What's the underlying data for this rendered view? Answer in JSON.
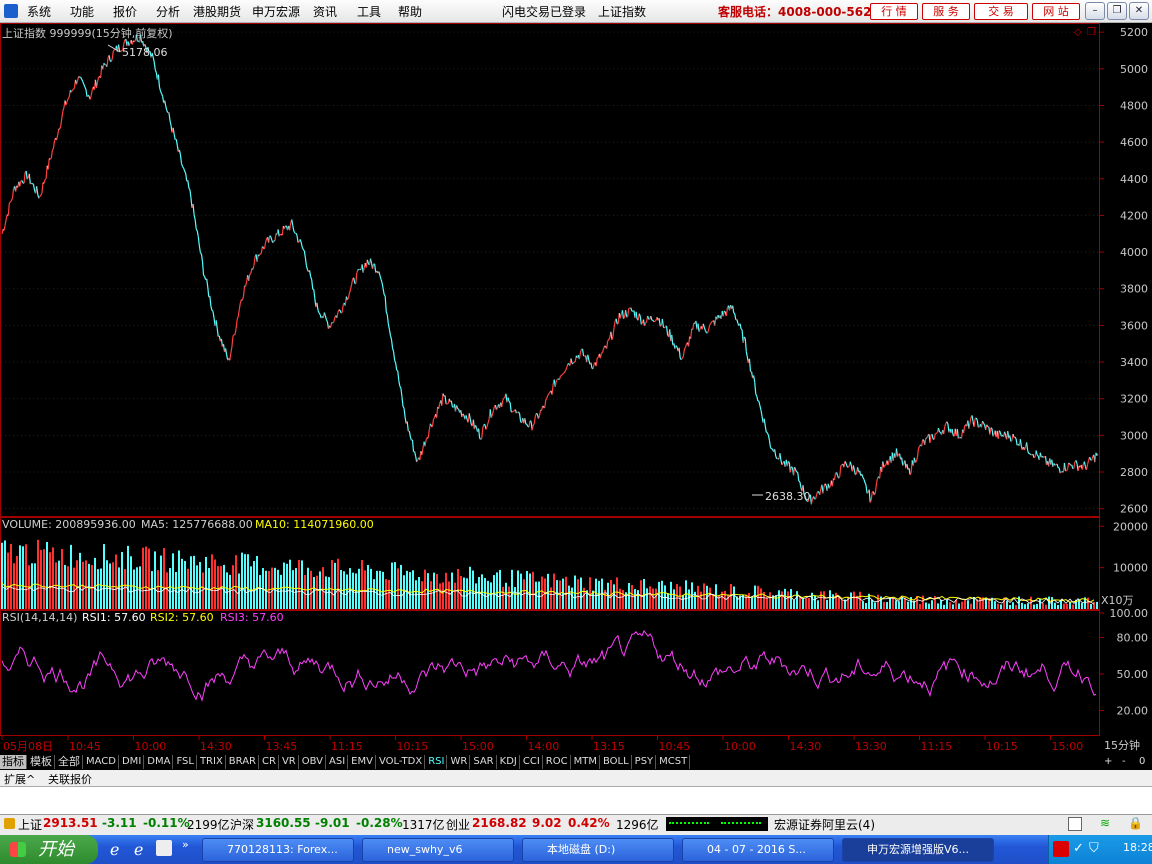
{
  "menubar": {
    "items": [
      "系统",
      "功能",
      "报价",
      "分析",
      "港股期货",
      "申万宏源",
      "资讯",
      "工具",
      "帮助"
    ],
    "status": "闪电交易已登录",
    "symbol": "上证指数",
    "hotline": "客服电话：4008-000-562",
    "buttons": [
      "行 情",
      "服 务",
      "交 易",
      "网 站"
    ]
  },
  "chart": {
    "title": "上证指数 999999(15分钟,前复权)",
    "high_label": "5178.06",
    "low_label": "2638.30",
    "y_ticks": [
      "5200",
      "5000",
      "4800",
      "4600",
      "4400",
      "4200",
      "4000",
      "3800",
      "3600",
      "3400",
      "3200",
      "3000",
      "2800",
      "2600"
    ],
    "x_labels": [
      "05月08日",
      "10:45",
      "10:00",
      "14:30",
      "13:45",
      "11:15",
      "10:15",
      "15:00",
      "14:00",
      "13:15",
      "10:45",
      "10:00",
      "14:30",
      "13:30",
      "11:15",
      "10:15",
      "15:00"
    ],
    "period": "15分钟"
  },
  "volume": {
    "label": "VOLUME: 200895936.00",
    "ma5": "MA5: 125776688.00",
    "ma10": "MA10: 114071960.00",
    "ticks": [
      "20000",
      "10000"
    ],
    "unit": "X10万"
  },
  "rsi": {
    "label": "RSI(14,14,14)",
    "rsi1": "RSI1: 57.60",
    "rsi2": "RSI2: 57.60",
    "rsi3": "RSI3: 57.60",
    "ticks": [
      "100.00",
      "80.00",
      "50.00",
      "20.00"
    ]
  },
  "indicator_tabs": [
    "指标",
    "模板",
    "全部",
    "MACD",
    "DMI",
    "DMA",
    "FSL",
    "TRIX",
    "BRAR",
    "CR",
    "VR",
    "OBV",
    "ASI",
    "EMV",
    "VOL-TDX",
    "RSI",
    "WR",
    "SAR",
    "KDJ",
    "CCI",
    "ROC",
    "MTM",
    "BOLL",
    "PSY",
    "MCST"
  ],
  "indicator_right": [
    "+",
    "-",
    "0"
  ],
  "lower_tabs": [
    "扩展^",
    "关联报价"
  ],
  "statusbar": {
    "sh_name": "上证",
    "sh_value": "2913.51",
    "sh_change": "-3.11",
    "sh_pct": "-0.11%",
    "sh_amount": "2199亿",
    "hs_name": "沪深",
    "hs_value": "3160.55",
    "hs_change": "-9.01",
    "hs_pct": "-0.28%",
    "hs_amount": "1317亿",
    "cy_name": "创业",
    "cy_value": "2168.82",
    "cy_change": "9.02",
    "cy_pct": "0.42%",
    "cy_amount": "1296亿",
    "broker": "宏源证券阿里云(4)"
  },
  "taskbar": {
    "start": "开始",
    "tasks": [
      "770128113: Forex...",
      "new_swhy_v6",
      "本地磁盘 (D:)",
      "04 - 07 - 2016 S...",
      "申万宏源增强版V6..."
    ],
    "clock": "18:28"
  },
  "chart_data": {
    "type": "line",
    "title": "上证指数 999999(15分钟,前复权)",
    "ylim": [
      2560,
      5250
    ],
    "x_labels": [
      "05月08日",
      "10:45",
      "10:00",
      "14:30",
      "13:45",
      "11:15",
      "10:15",
      "15:00",
      "14:00",
      "13:15",
      "10:45",
      "10:00",
      "14:30",
      "13:30",
      "11:15",
      "10:15",
      "15:00"
    ],
    "series": [
      {
        "name": "上证指数",
        "values": [
          4100,
          4350,
          4420,
          4300,
          4550,
          4800,
          4950,
          4850,
          5000,
          5100,
          5150,
          5178,
          5050,
          4800,
          4550,
          4300,
          3900,
          3600,
          3400,
          3750,
          3950,
          4050,
          4100,
          4150,
          4000,
          3700,
          3600,
          3700,
          3850,
          3950,
          3900,
          3500,
          3100,
          2850,
          3050,
          3200,
          3150,
          3100,
          3000,
          3150,
          3200,
          3100,
          3050,
          3150,
          3300,
          3400,
          3450,
          3380,
          3480,
          3650,
          3680,
          3620,
          3650,
          3550,
          3420,
          3600,
          3580,
          3650,
          3700,
          3500,
          3200,
          2950,
          2850,
          2800,
          2638,
          2700,
          2750,
          2850,
          2800,
          2650,
          2850,
          2900,
          2800,
          2950,
          3000,
          3050,
          3000,
          3080,
          3050,
          3000,
          3000,
          2950,
          2900,
          2850,
          2820,
          2840,
          2830,
          2900
        ]
      }
    ],
    "annotations": [
      {
        "label": "5178.06",
        "value": 5178.06
      },
      {
        "label": "2638.30",
        "value": 2638.3
      }
    ]
  }
}
